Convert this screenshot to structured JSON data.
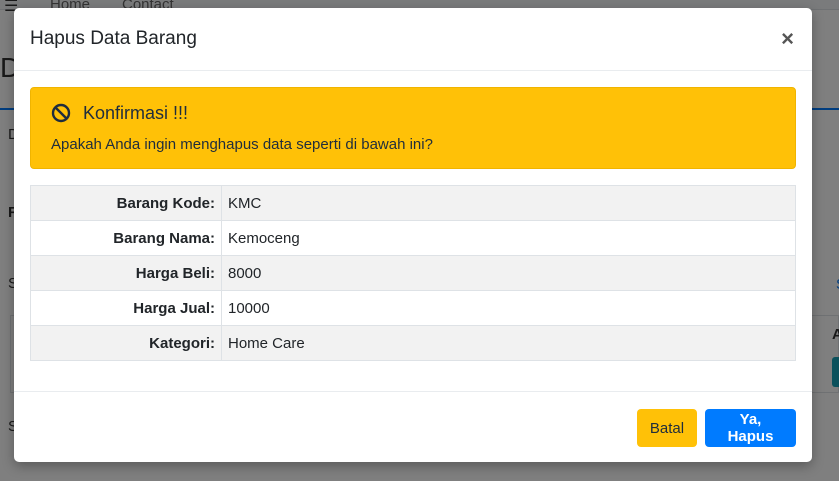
{
  "background": {
    "nav": [
      "Home",
      "Contact"
    ],
    "title_letter": "D",
    "fragments": [
      "D",
      "F",
      "S",
      "S",
      "A",
      "S"
    ]
  },
  "modal": {
    "title": "Hapus Data Barang",
    "close_label": "×"
  },
  "alert": {
    "icon": "ban-icon",
    "title": "Konfirmasi !!!",
    "message": "Apakah Anda ingin menghapus data seperti di bawah ini?",
    "color": "#ffc107"
  },
  "details": [
    {
      "label": "Barang Kode:",
      "value": "KMC"
    },
    {
      "label": "Barang Nama:",
      "value": "Kemoceng"
    },
    {
      "label": "Harga Beli:",
      "value": "8000"
    },
    {
      "label": "Harga Jual:",
      "value": "10000"
    },
    {
      "label": "Kategori:",
      "value": "Home Care"
    }
  ],
  "footer": {
    "cancel_label": "Batal",
    "confirm_label": "Ya, Hapus",
    "cancel_color": "#ffc107",
    "confirm_color": "#007bff"
  }
}
